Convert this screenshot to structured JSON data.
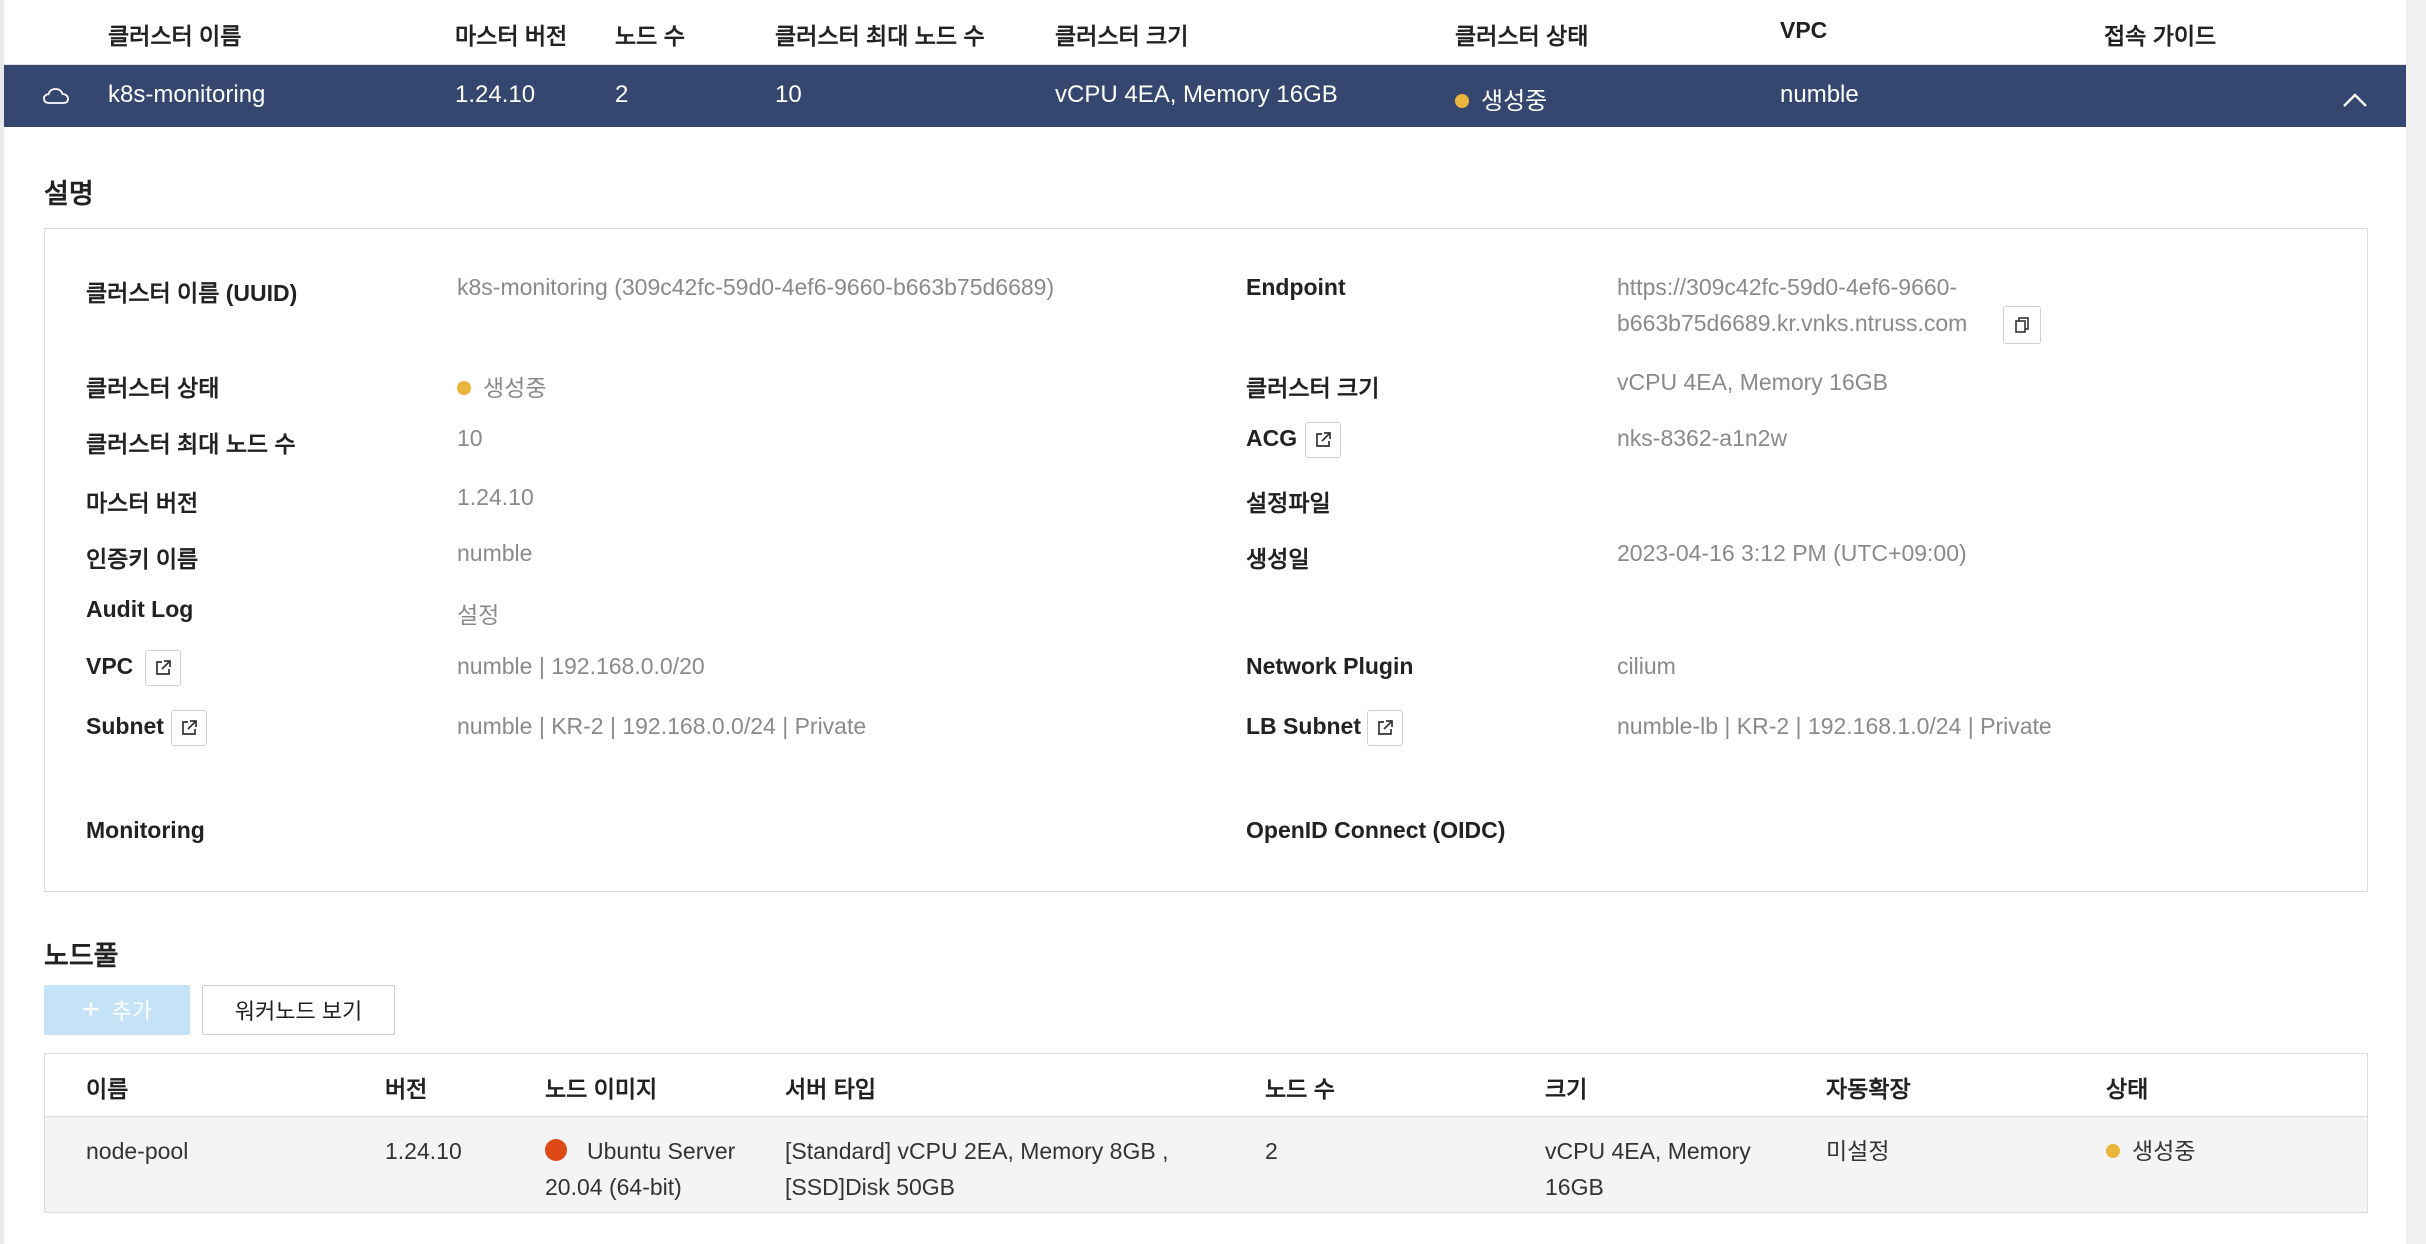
{
  "header": {
    "cols": [
      "클러스터 이름",
      "마스터 버전",
      "노드 수",
      "클러스터 최대 노드 수",
      "클러스터 크기",
      "클러스터 상태",
      "VPC",
      "접속 가이드"
    ]
  },
  "cluster_row": {
    "name": "k8s-monitoring",
    "master_version": "1.24.10",
    "nodes": "2",
    "max_nodes": "10",
    "size": "vCPU 4EA, Memory 16GB",
    "status": "생성중",
    "vpc": "numble",
    "icon": "cloud-icon"
  },
  "description": {
    "title": "설명",
    "uuid_label": "클러스터 이름 (UUID)",
    "uuid_value": "k8s-monitoring (309c42fc-59d0-4ef6-9660-b663b75d6689)",
    "endpoint_label": "Endpoint",
    "endpoint_line1": "https://309c42fc-59d0-4ef6-9660-",
    "endpoint_line2": "b663b75d6689.kr.vnks.ntruss.com",
    "status_label": "클러스터 상태",
    "status_value": "생성중",
    "size_label": "클러스터 크기",
    "size_value": "vCPU 4EA, Memory 16GB",
    "max_nodes_label": "클러스터 최대 노드 수",
    "max_nodes_value": "10",
    "acg_label": "ACG",
    "acg_value": "nks-8362-a1n2w",
    "master_label": "마스터 버전",
    "master_value": "1.24.10",
    "config_label": "설정파일",
    "authkey_label": "인증키 이름",
    "authkey_value": "numble",
    "created_label": "생성일",
    "created_value": "2023-04-16 3:12 PM (UTC+09:00)",
    "audit_label": "Audit Log",
    "audit_value": "설정",
    "vpc_label": "VPC",
    "vpc_value": "numble | 192.168.0.0/20",
    "plugin_label": "Network Plugin",
    "plugin_value": "cilium",
    "subnet_label": "Subnet",
    "subnet_value": "numble | KR-2 | 192.168.0.0/24 | Private",
    "lb_label": "LB Subnet",
    "lb_value": "numble-lb | KR-2 | 192.168.1.0/24 | Private",
    "monitoring_label": "Monitoring",
    "oidc_label": "OpenID Connect (OIDC)"
  },
  "nodepool": {
    "title": "노드풀",
    "add_label": "추가",
    "worker_label": "워커노드 보기",
    "cols": [
      "이름",
      "버전",
      "노드 이미지",
      "서버 타입",
      "노드 수",
      "크기",
      "자동확장",
      "상태"
    ],
    "row": {
      "name": "node-pool",
      "version": "1.24.10",
      "image_line1": "Ubuntu Server",
      "image_line2": "20.04 (64-bit)",
      "server_line1": "[Standard] vCPU 2EA, Memory 8GB ,",
      "server_line2": "[SSD]Disk 50GB",
      "nodes": "2",
      "size_line1": "vCPU 4EA, Memory",
      "size_line2": "16GB",
      "autoscale": "미설정",
      "status": "생성중"
    }
  },
  "colors": {
    "row_bg": "#35466f",
    "status_dot": "#e9b53c",
    "add_btn": "#c5e3f6"
  }
}
